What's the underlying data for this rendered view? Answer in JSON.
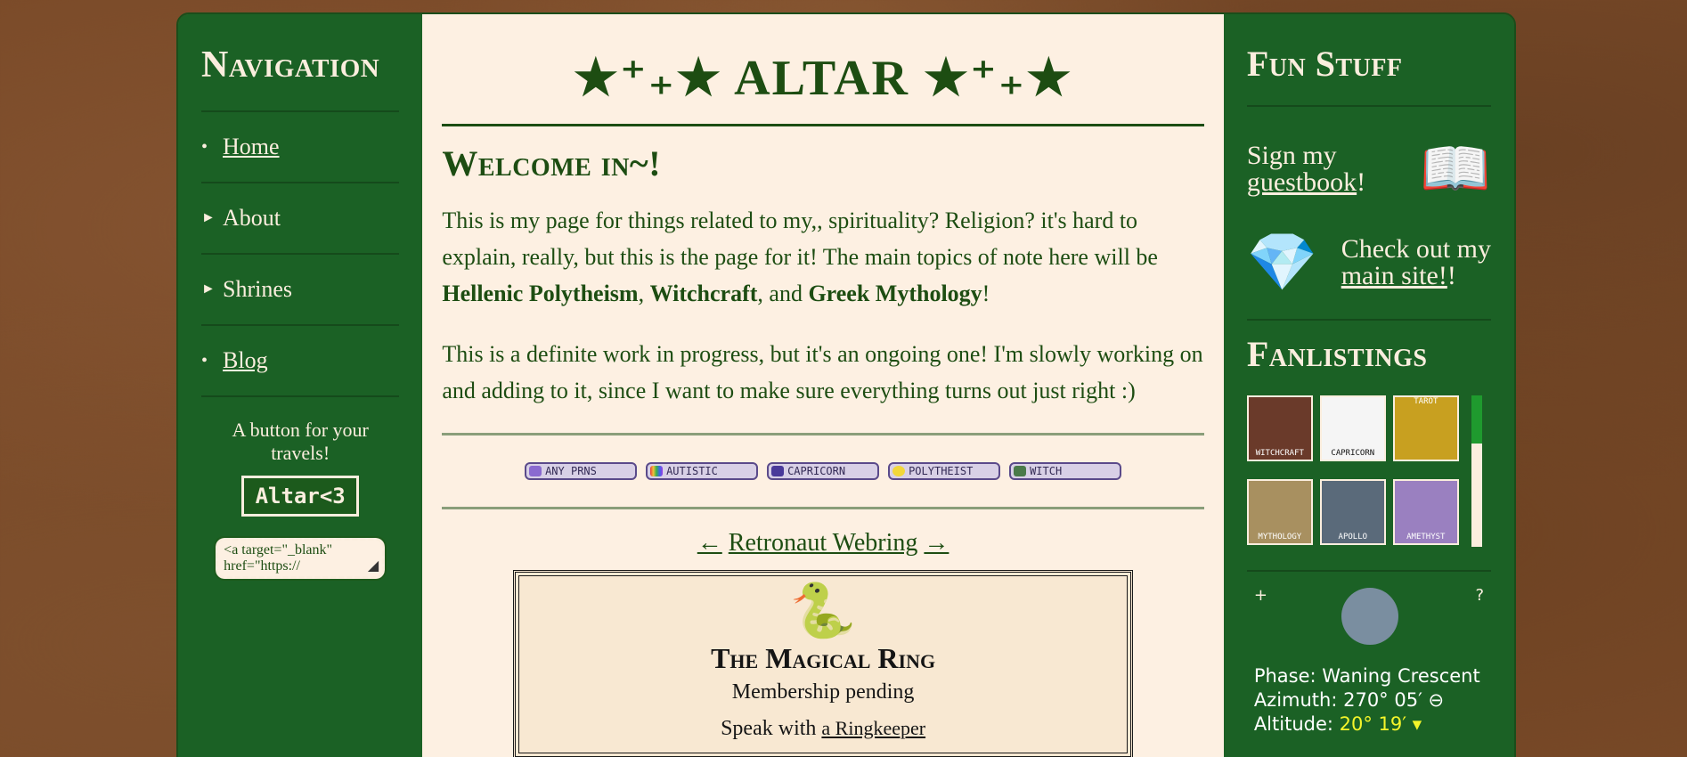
{
  "nav": {
    "title": "Navigation",
    "items": [
      {
        "label": "Home",
        "marker": "•"
      },
      {
        "label": "About",
        "marker": "►"
      },
      {
        "label": "Shrines",
        "marker": "►"
      },
      {
        "label": "Blog",
        "marker": "•"
      }
    ],
    "button_caption": "A button for your travels!",
    "button_text": "Altar<3",
    "code_snippet": "<a target=\"_blank\" href=\"https://"
  },
  "main": {
    "site_title": "★⁺₊★ ALTAR ★⁺₊★",
    "welcome": "Welcome in~!",
    "para1_a": "This is my page for things related to my,, spirituality? Religion? it's hard to explain, really, but this is the page for it! The main topics of note here will be ",
    "para1_b1": "Hellenic Polytheism",
    "para1_sep1": ", ",
    "para1_b2": "Witchcraft",
    "para1_sep2": ", and ",
    "para1_b3": "Greek Mythology",
    "para1_end": "!",
    "para2": "This is a definite work in progress, but it's an ongoing one! I'm slowly working on and adding to it, since I want to make sure everything turns out just right :)",
    "stamps": [
      {
        "label": "ANY PRNS",
        "color": "#8a6ad0"
      },
      {
        "label": "AUTISTIC",
        "color": "#e6a03a"
      },
      {
        "label": "CAPRICORN",
        "color": "#4a3a9a"
      },
      {
        "label": "POLYTHEIST",
        "color": "#f2d73a"
      },
      {
        "label": "WITCH",
        "color": "#4a7a4a"
      }
    ],
    "webring": {
      "prev": "←",
      "name": "Retronaut Webring",
      "next": "→"
    },
    "ring": {
      "title": "The Magical Ring",
      "status": "Membership pending",
      "speak_prefix": "Speak with ",
      "speak_link": "a Ringkeeper"
    }
  },
  "fun": {
    "title": "Fun Stuff",
    "guestbook_prefix": "Sign my",
    "guestbook_link": "guestbook",
    "guestbook_suffix": "!",
    "main_prefix": "Check out my",
    "main_link": "main site!",
    "main_suffix": "!",
    "fanlistings_title": "Fanlistings",
    "fanlistings": [
      {
        "label": "WITCHCRAFT",
        "color": "#6a3a2a"
      },
      {
        "label": "CAPRICORN",
        "color": "#1a1a1a"
      },
      {
        "label": "TAROT",
        "color": "#c8a020"
      },
      {
        "label": "MYTHOLOGY",
        "color": "#a89060"
      },
      {
        "label": "APOLLO",
        "color": "#5a6a7a"
      },
      {
        "label": "AMETHYST",
        "color": "#9a80c0"
      }
    ],
    "moon": {
      "plus": "+",
      "question": "?",
      "phase": "Phase: Waning Crescent",
      "azimuth": "Azimuth: 270°  05′ ⊖",
      "altitude_label": "Altitude: ",
      "altitude_value": "20°  19′ ▾"
    }
  }
}
